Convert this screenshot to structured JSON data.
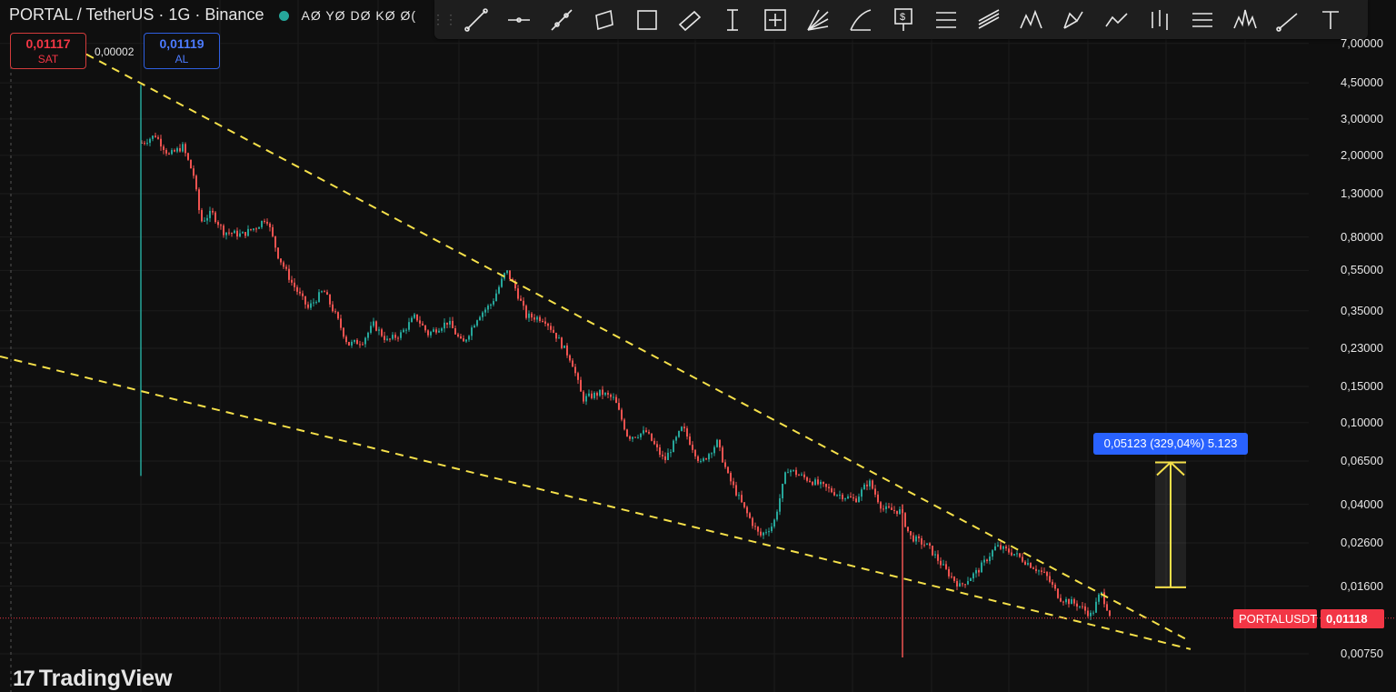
{
  "symbol": {
    "name": "PORTAL / TetherUS · 1G · Binance",
    "ohlc": "AØ YØ DØ KØ Ø("
  },
  "trade": {
    "sell_price": "0,01117",
    "sell_label": "SAT",
    "spread": "0,00002",
    "buy_price": "0,01119",
    "buy_label": "AL"
  },
  "toolbar": {
    "tools": [
      "trend-line-icon",
      "horizontal-ray-icon",
      "extended-line-icon",
      "parallel-channel-icon",
      "rectangle-icon",
      "rotated-rectangle-icon",
      "vertical-line-icon",
      "measure-box-icon",
      "fib-fan-icon",
      "arc-icon",
      "price-note-icon",
      "fib-retracement-icon",
      "pitchfork-icon",
      "elliott-wave-icon",
      "xabcd-pattern-icon",
      "path-icon",
      "bars-pattern-icon",
      "gann-box-icon",
      "head-shoulders-icon",
      "ray-icon",
      "text-icon"
    ]
  },
  "price_axis": [
    "7,00000",
    "4,50000",
    "3,00000",
    "2,00000",
    "1,30000",
    "0,80000",
    "0,55000",
    "0,35000",
    "0,23000",
    "0,15000",
    "0,10000",
    "0,06500",
    "0,04000",
    "0,02600",
    "0,01600",
    "0,00750"
  ],
  "price_tags": {
    "symbol": "PORTALUSDT",
    "last": "0,01118"
  },
  "measure": {
    "label": "0,05123 (329,04%) 5.123"
  },
  "logo": {
    "text": "TradingView"
  },
  "colors": {
    "background": "#0f0f0f",
    "up": "#26a69a",
    "down": "#ef5350",
    "trendline": "#f5e04a",
    "accent": "#2962ff"
  },
  "chart_data": {
    "type": "candlestick",
    "scale": "log",
    "ylim": [
      0.0065,
      7.2
    ],
    "path": [
      {
        "x": 155,
        "y": 2.3
      },
      {
        "x": 170,
        "y": 2.5
      },
      {
        "x": 185,
        "y": 2.0
      },
      {
        "x": 200,
        "y": 2.2
      },
      {
        "x": 212,
        "y": 1.6
      },
      {
        "x": 220,
        "y": 0.95
      },
      {
        "x": 232,
        "y": 1.05
      },
      {
        "x": 245,
        "y": 0.85
      },
      {
        "x": 265,
        "y": 0.82
      },
      {
        "x": 282,
        "y": 0.9
      },
      {
        "x": 292,
        "y": 1.0
      },
      {
        "x": 305,
        "y": 0.65
      },
      {
        "x": 320,
        "y": 0.48
      },
      {
        "x": 338,
        "y": 0.36
      },
      {
        "x": 355,
        "y": 0.44
      },
      {
        "x": 370,
        "y": 0.32
      },
      {
        "x": 382,
        "y": 0.24
      },
      {
        "x": 398,
        "y": 0.25
      },
      {
        "x": 410,
        "y": 0.3
      },
      {
        "x": 425,
        "y": 0.25
      },
      {
        "x": 440,
        "y": 0.27
      },
      {
        "x": 456,
        "y": 0.33
      },
      {
        "x": 470,
        "y": 0.27
      },
      {
        "x": 492,
        "y": 0.31
      },
      {
        "x": 508,
        "y": 0.24
      },
      {
        "x": 525,
        "y": 0.33
      },
      {
        "x": 540,
        "y": 0.38
      },
      {
        "x": 556,
        "y": 0.55
      },
      {
        "x": 566,
        "y": 0.45
      },
      {
        "x": 578,
        "y": 0.33
      },
      {
        "x": 598,
        "y": 0.32
      },
      {
        "x": 612,
        "y": 0.26
      },
      {
        "x": 628,
        "y": 0.2
      },
      {
        "x": 640,
        "y": 0.13
      },
      {
        "x": 660,
        "y": 0.14
      },
      {
        "x": 675,
        "y": 0.13
      },
      {
        "x": 690,
        "y": 0.085
      },
      {
        "x": 710,
        "y": 0.09
      },
      {
        "x": 730,
        "y": 0.065
      },
      {
        "x": 750,
        "y": 0.095
      },
      {
        "x": 770,
        "y": 0.063
      },
      {
        "x": 788,
        "y": 0.08
      },
      {
        "x": 800,
        "y": 0.055
      },
      {
        "x": 818,
        "y": 0.038
      },
      {
        "x": 835,
        "y": 0.028
      },
      {
        "x": 850,
        "y": 0.032
      },
      {
        "x": 865,
        "y": 0.06
      },
      {
        "x": 880,
        "y": 0.055
      },
      {
        "x": 900,
        "y": 0.05
      },
      {
        "x": 920,
        "y": 0.045
      },
      {
        "x": 940,
        "y": 0.042
      },
      {
        "x": 955,
        "y": 0.052
      },
      {
        "x": 970,
        "y": 0.038
      },
      {
        "x": 990,
        "y": 0.037
      },
      {
        "x": 1000,
        "y": 0.028
      },
      {
        "x": 1020,
        "y": 0.025
      },
      {
        "x": 1040,
        "y": 0.019
      },
      {
        "x": 1055,
        "y": 0.016
      },
      {
        "x": 1075,
        "y": 0.019
      },
      {
        "x": 1095,
        "y": 0.025
      },
      {
        "x": 1115,
        "y": 0.023
      },
      {
        "x": 1135,
        "y": 0.02
      },
      {
        "x": 1150,
        "y": 0.018
      },
      {
        "x": 1165,
        "y": 0.014
      },
      {
        "x": 1185,
        "y": 0.013
      },
      {
        "x": 1200,
        "y": 0.0115
      },
      {
        "x": 1210,
        "y": 0.015
      },
      {
        "x": 1222,
        "y": 0.01118
      }
    ],
    "wicks": [
      {
        "x": 155,
        "high": 4.4,
        "low": 0.055
      },
      {
        "x": 993,
        "high": 0.04,
        "low": 0.0072
      }
    ],
    "trendlines": [
      {
        "x1": 95,
        "y1": 6.2,
        "x2": 1310,
        "y2": 0.0086
      },
      {
        "x1": 0,
        "y1": 0.21,
        "x2": 1310,
        "y2": 0.0079
      }
    ],
    "measure": {
      "x": 1288,
      "from": 0.0158,
      "to": 0.064
    },
    "last_price": 0.01118
  }
}
